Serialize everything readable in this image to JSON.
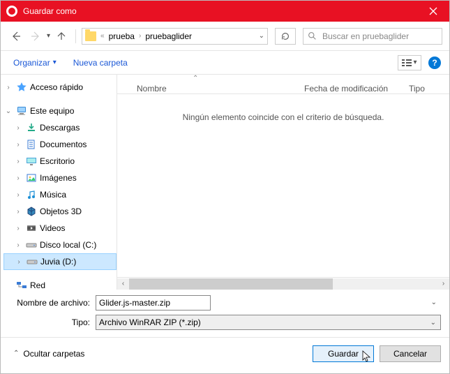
{
  "title": "Guardar como",
  "breadcrumbs": [
    "prueba",
    "pruebaglider"
  ],
  "search_placeholder": "Buscar en pruebaglider",
  "toolbar": {
    "organize": "Organizar",
    "new_folder": "Nueva carpeta"
  },
  "tree": {
    "quick_access": "Acceso rápido",
    "this_pc": "Este equipo",
    "children": [
      "Descargas",
      "Documentos",
      "Escritorio",
      "Imágenes",
      "Música",
      "Objetos 3D",
      "Videos",
      "Disco local (C:)",
      "Juvia (D:)"
    ],
    "network": "Red"
  },
  "columns": {
    "name": "Nombre",
    "modified": "Fecha de modificación",
    "type": "Tipo"
  },
  "empty": "Ningún elemento coincide con el criterio de búsqueda.",
  "form": {
    "filename_label": "Nombre de archivo:",
    "filename_value": "Glider.js-master.zip",
    "type_label": "Tipo:",
    "type_value": "Archivo WinRAR ZIP (*.zip)"
  },
  "footer": {
    "hide_folders": "Ocultar carpetas",
    "save": "Guardar",
    "cancel": "Cancelar"
  },
  "help_glyph": "?"
}
